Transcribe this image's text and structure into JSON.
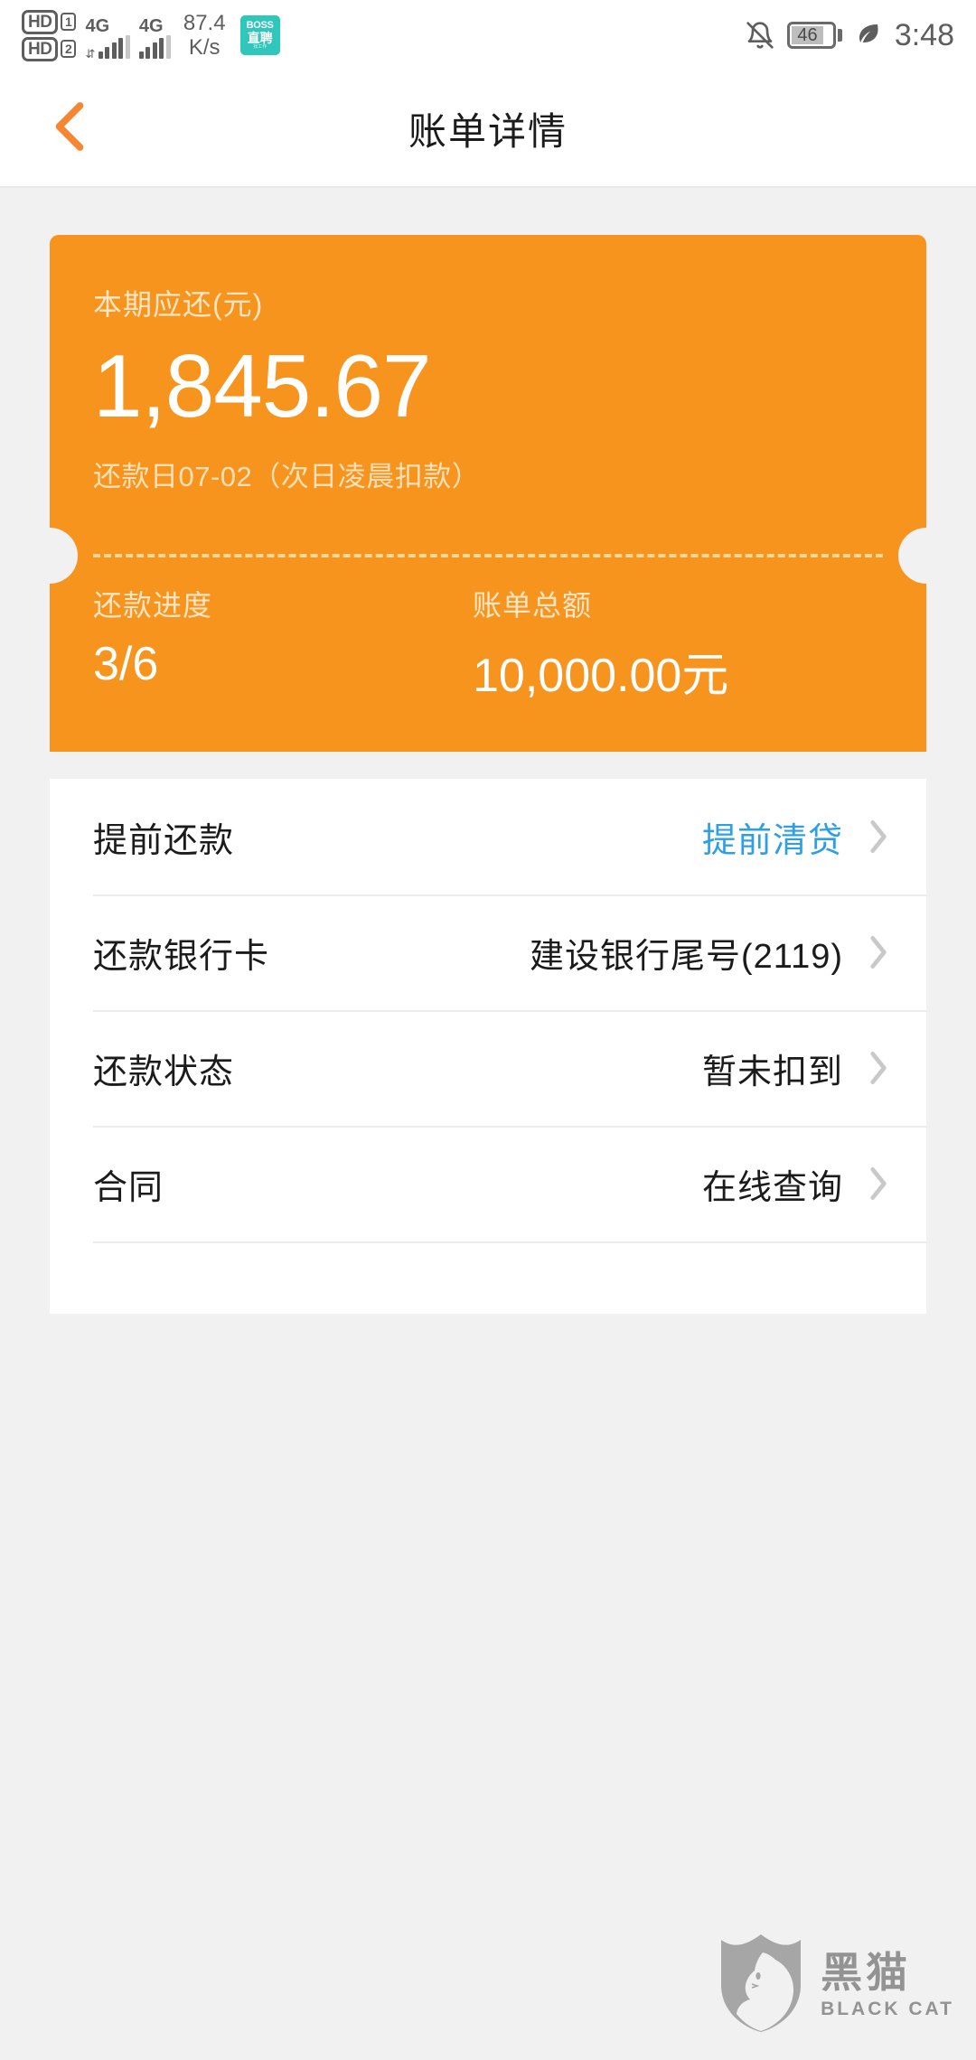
{
  "status_bar": {
    "hd1_label": "HD",
    "hd1_num": "1",
    "hd2_label": "HD",
    "hd2_num": "2",
    "sim1_network": "4G",
    "sim2_network": "4G",
    "speed_value": "87.4",
    "speed_unit": "K/s",
    "app_icon": {
      "line1": "BOSS",
      "line2": "直聘",
      "line3": "找工作"
    },
    "bell_icon": "bell-muted-icon",
    "battery_level": "46",
    "eco_icon": "leaf-icon",
    "time": "3:48"
  },
  "title_bar": {
    "back_icon": "chevron-left-icon",
    "title": "账单详情"
  },
  "bill_card": {
    "due_label": "本期应还(元)",
    "due_amount": "1,845.67",
    "due_note": "还款日07-02（次日凌晨扣款）",
    "progress_label": "还款进度",
    "progress_value": "3/6",
    "total_label": "账单总额",
    "total_value": "10,000.00元"
  },
  "detail_rows": [
    {
      "label": "提前还款",
      "value": "提前清贷",
      "is_link": true
    },
    {
      "label": "还款银行卡",
      "value": "建设银行尾号(2119)",
      "is_link": false
    },
    {
      "label": "还款状态",
      "value": "暂未扣到",
      "is_link": false
    },
    {
      "label": "合同",
      "value": "在线查询",
      "is_link": false
    }
  ],
  "watermark": {
    "cn": "黑猫",
    "en": "BLACK CAT",
    "icon": "black-cat-shield-logo"
  },
  "colors": {
    "accent_orange": "#f7941e",
    "link_blue": "#2e9fe6",
    "page_background": "#f1f1f1",
    "card_white": "#ffffff",
    "status_gray": "#5e5e5e"
  }
}
